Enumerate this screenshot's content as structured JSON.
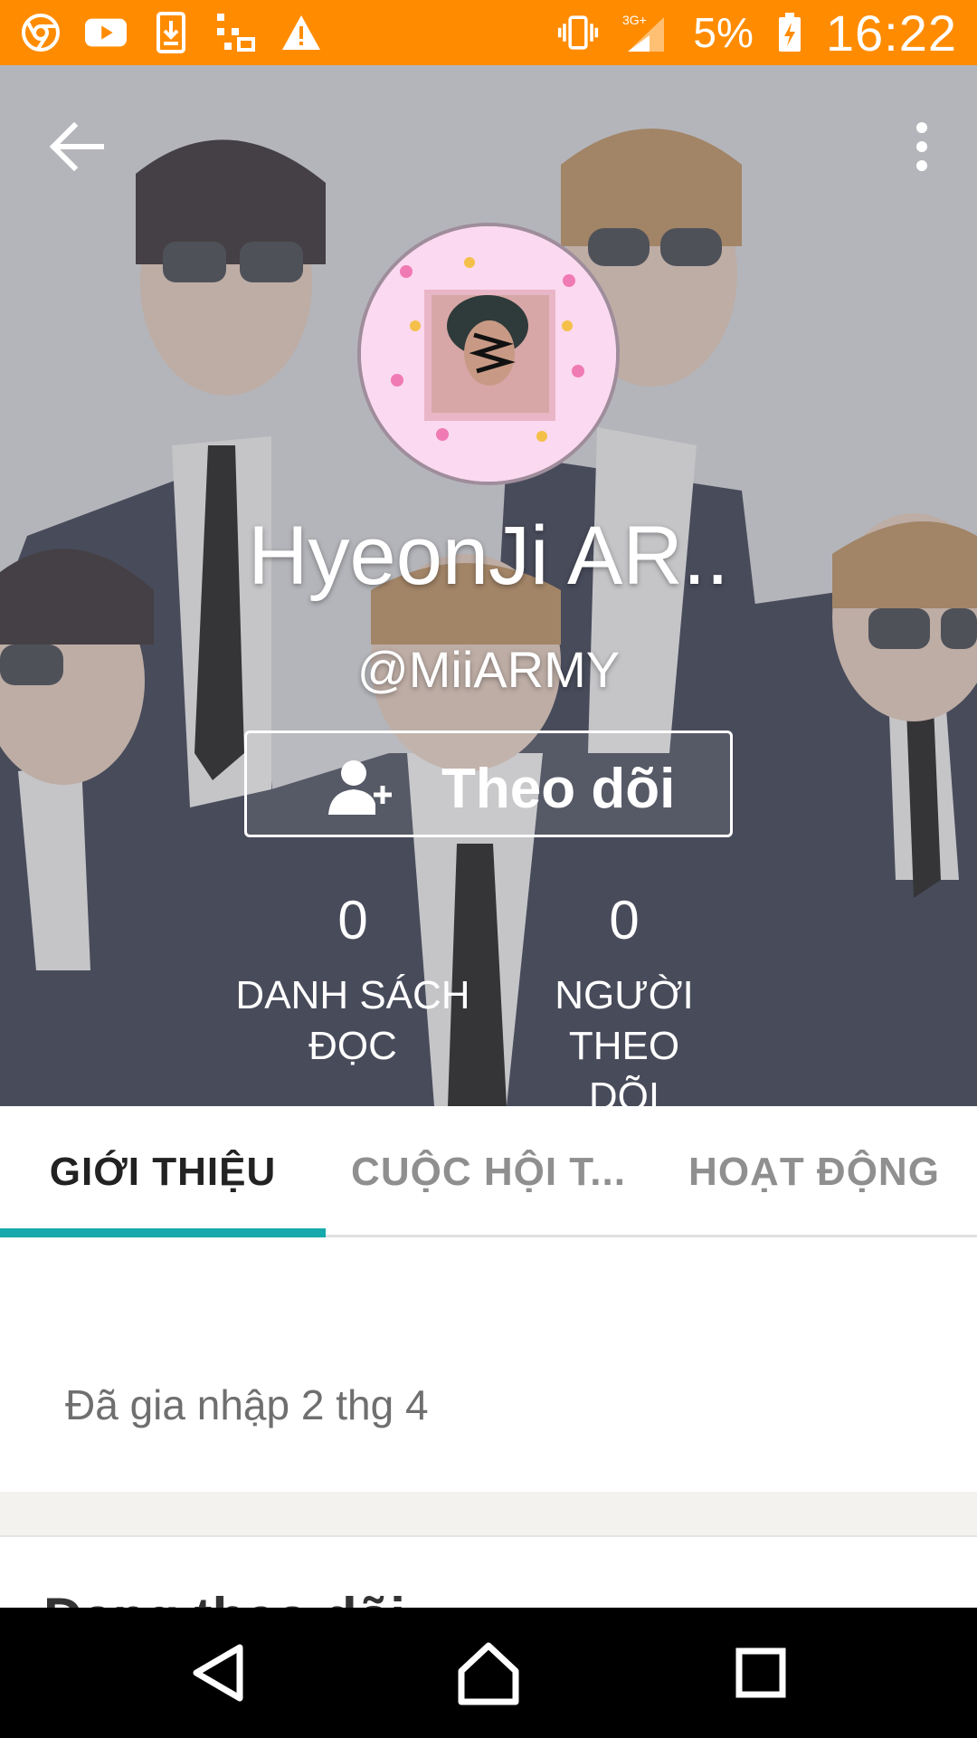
{
  "status_bar": {
    "icons_left": [
      "chrome-icon",
      "youtube-icon",
      "download-icon",
      "usb-debug-icon",
      "warning-icon"
    ],
    "icons_right": [
      "vibrate-icon",
      "signal-3g-icon",
      "battery-charging-icon"
    ],
    "network": "3G+",
    "battery": "5%",
    "time": "16:22",
    "color": "#ff8c00"
  },
  "profile": {
    "display_name": "HyeonJi AR..",
    "username": "@MiiARMY",
    "follow_label": "Theo dõi",
    "stats": [
      {
        "count": "0",
        "label_line1": "DANH SÁCH",
        "label_line2": "ĐỌC"
      },
      {
        "count": "0",
        "label_line1": "NGƯỜI THEO",
        "label_line2": "DÕI"
      }
    ]
  },
  "tabs": [
    {
      "label": "GIỚI THIỆU",
      "active": true
    },
    {
      "label": "CUỘC HỘI T...",
      "active": false
    },
    {
      "label": "HOẠT ĐỘNG",
      "active": false
    }
  ],
  "about": {
    "joined": "Đã gia nhập 2 thg 4"
  },
  "section": {
    "partial_heading": "Đang theo dõi"
  },
  "accent_color": "#18a9ad"
}
